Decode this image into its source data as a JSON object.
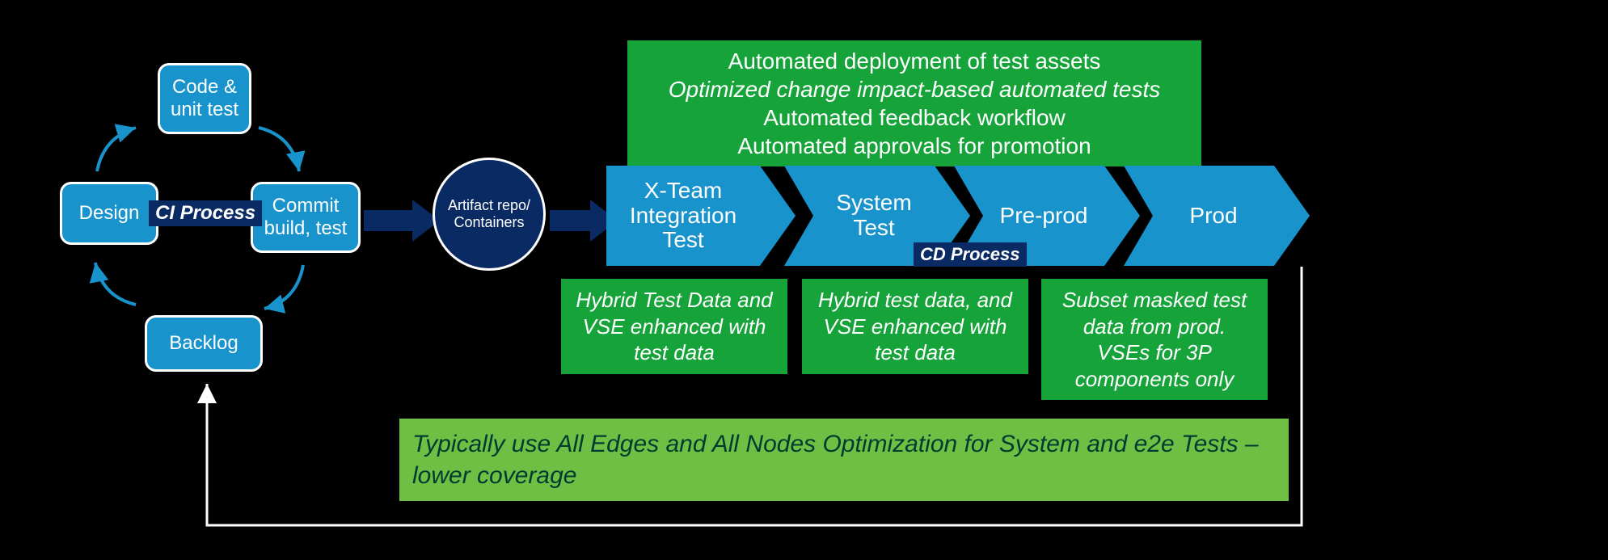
{
  "ci_cycle": {
    "design": "Design",
    "code_unit": "Code & unit test",
    "commit_build": "Commit build, test",
    "backlog": "Backlog",
    "label": "CI Process"
  },
  "artifact": "Artifact repo/ Containers",
  "chevrons": {
    "xteam": "X-Team Integration Test",
    "system": "System Test",
    "preprod": "Pre-prod",
    "prod": "Prod"
  },
  "cd_label": "CD Process",
  "top_banner": {
    "line1": "Automated deployment of test assets",
    "line2": "Optimized change impact-based automated tests",
    "line3": "Automated feedback workflow",
    "line4": "Automated approvals for promotion"
  },
  "notes": {
    "xteam": "Hybrid Test Data and VSE enhanced with test data",
    "system": "Hybrid test data, and VSE enhanced with test data",
    "preprod": "Subset masked test data from prod. VSEs for 3P components only"
  },
  "footer": "Typically use All Edges and All Nodes Optimization for System and e2e Tests – lower coverage"
}
